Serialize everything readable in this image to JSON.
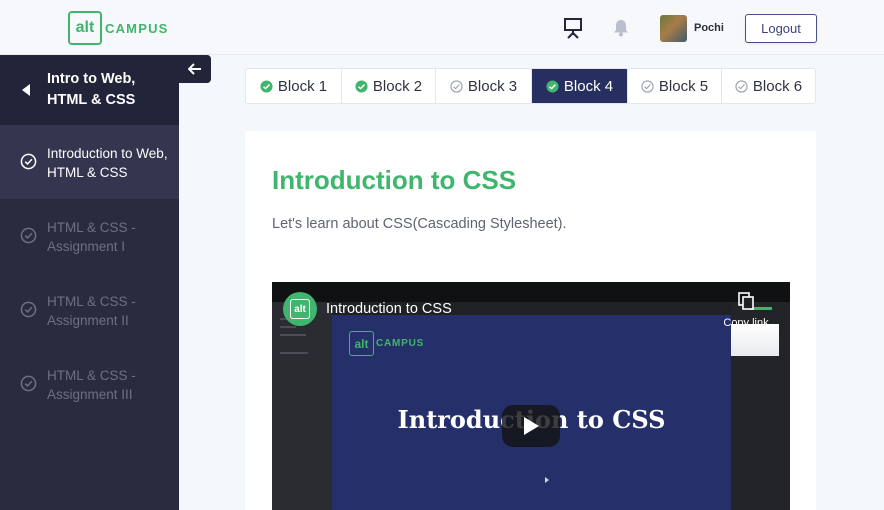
{
  "header": {
    "logo": {
      "mark": "alt",
      "text": "CAMPUS"
    },
    "icons": [
      "presentation-icon",
      "bell-icon"
    ],
    "user": {
      "name": "Pochi"
    },
    "logout_label": "Logout"
  },
  "sidebar": {
    "title": "Intro to Web, HTML & CSS",
    "items": [
      {
        "label": "Introduction to Web, HTML & CSS",
        "active": true
      },
      {
        "label": "HTML & CSS - Assignment I",
        "active": false
      },
      {
        "label": "HTML & CSS - Assignment II",
        "active": false
      },
      {
        "label": "HTML & CSS - Assignment III",
        "active": false
      }
    ]
  },
  "tabs": [
    {
      "label": "Block 1",
      "completed": true,
      "active": false
    },
    {
      "label": "Block 2",
      "completed": true,
      "active": false
    },
    {
      "label": "Block 3",
      "completed": false,
      "active": false
    },
    {
      "label": "Block 4",
      "completed": true,
      "active": true
    },
    {
      "label": "Block 5",
      "completed": false,
      "active": false
    },
    {
      "label": "Block 6",
      "completed": false,
      "active": false
    }
  ],
  "content": {
    "title": "Introduction to CSS",
    "description": "Let's learn about CSS(Cascading Stylesheet).",
    "video": {
      "title": "Introduction to CSS",
      "copy_link_label": "Copy link",
      "slide_logo_mark": "alt",
      "slide_logo_text": "CAMPUS",
      "slide_title": "Introduction to CSS",
      "channel_mark": "alt"
    }
  },
  "colors": {
    "brand_green": "#3fb56d",
    "sidebar_bg": "#292b3f",
    "active_tab": "#262f5f"
  }
}
